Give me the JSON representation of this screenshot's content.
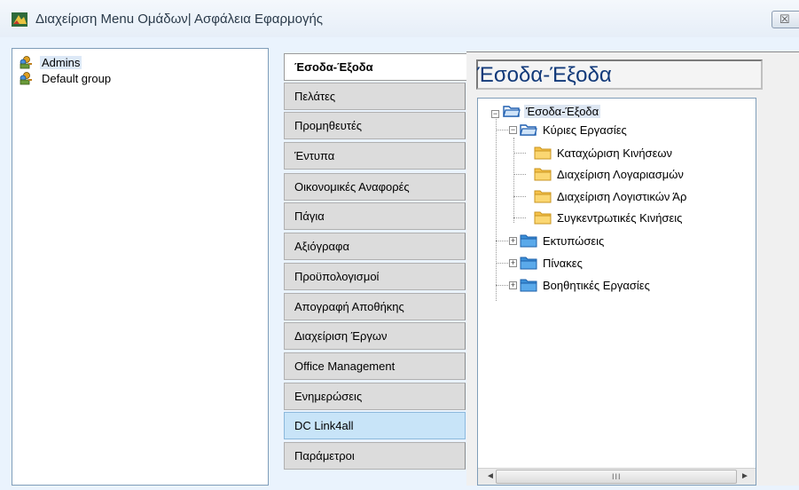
{
  "window": {
    "title": "Διαχείριση Menu Ομάδων| Ασφάλεια Εφαρμογής",
    "close_glyph": "☒"
  },
  "groups": [
    {
      "label": "Admins",
      "icon": "users-key-icon"
    },
    {
      "label": "Default group",
      "icon": "users-key-icon"
    }
  ],
  "tabs": [
    {
      "label": "Έσοδα-Έξοδα",
      "state": "active"
    },
    {
      "label": "Πελάτες"
    },
    {
      "label": "Προμηθευτές"
    },
    {
      "label": "Έντυπα"
    },
    {
      "label": "Οικονομικές Αναφορές"
    },
    {
      "label": "Πάγια"
    },
    {
      "label": "Αξιόγραφα"
    },
    {
      "label": "Προϋπολογισμοί"
    },
    {
      "label": "Απογραφή Αποθήκης"
    },
    {
      "label": "Διαχείριση Έργων"
    },
    {
      "label": "Office Management"
    },
    {
      "label": "Ενημερώσεις"
    },
    {
      "label": "DC Link4all",
      "state": "highlight"
    },
    {
      "label": "Παράμετροι"
    }
  ],
  "content": {
    "header": "Έσοδα-Έξοδα",
    "tree": {
      "root": "Έσοδα-Έξοδα",
      "main_tasks": "Κύριες Εργασίες",
      "main_children": [
        "Καταχώριση Κινήσεων",
        "Διαχείριση Λογαριασμών",
        "Διαχείριση Λογιστικών Άρ",
        "Συγκεντρωτικές Κινήσεις"
      ],
      "prints": "Εκτυπώσεις",
      "tables": "Πίνακες",
      "aux_tasks": "Βοηθητικές Εργασίες"
    },
    "scrollbar": {
      "left": "◄",
      "right": "►",
      "grip": "III"
    }
  },
  "colors": {
    "header_text": "#123a7a",
    "folder_blue": "#3a8fd8",
    "folder_yellow": "#f6c24a",
    "highlight_tab": "#c8e4f8"
  }
}
